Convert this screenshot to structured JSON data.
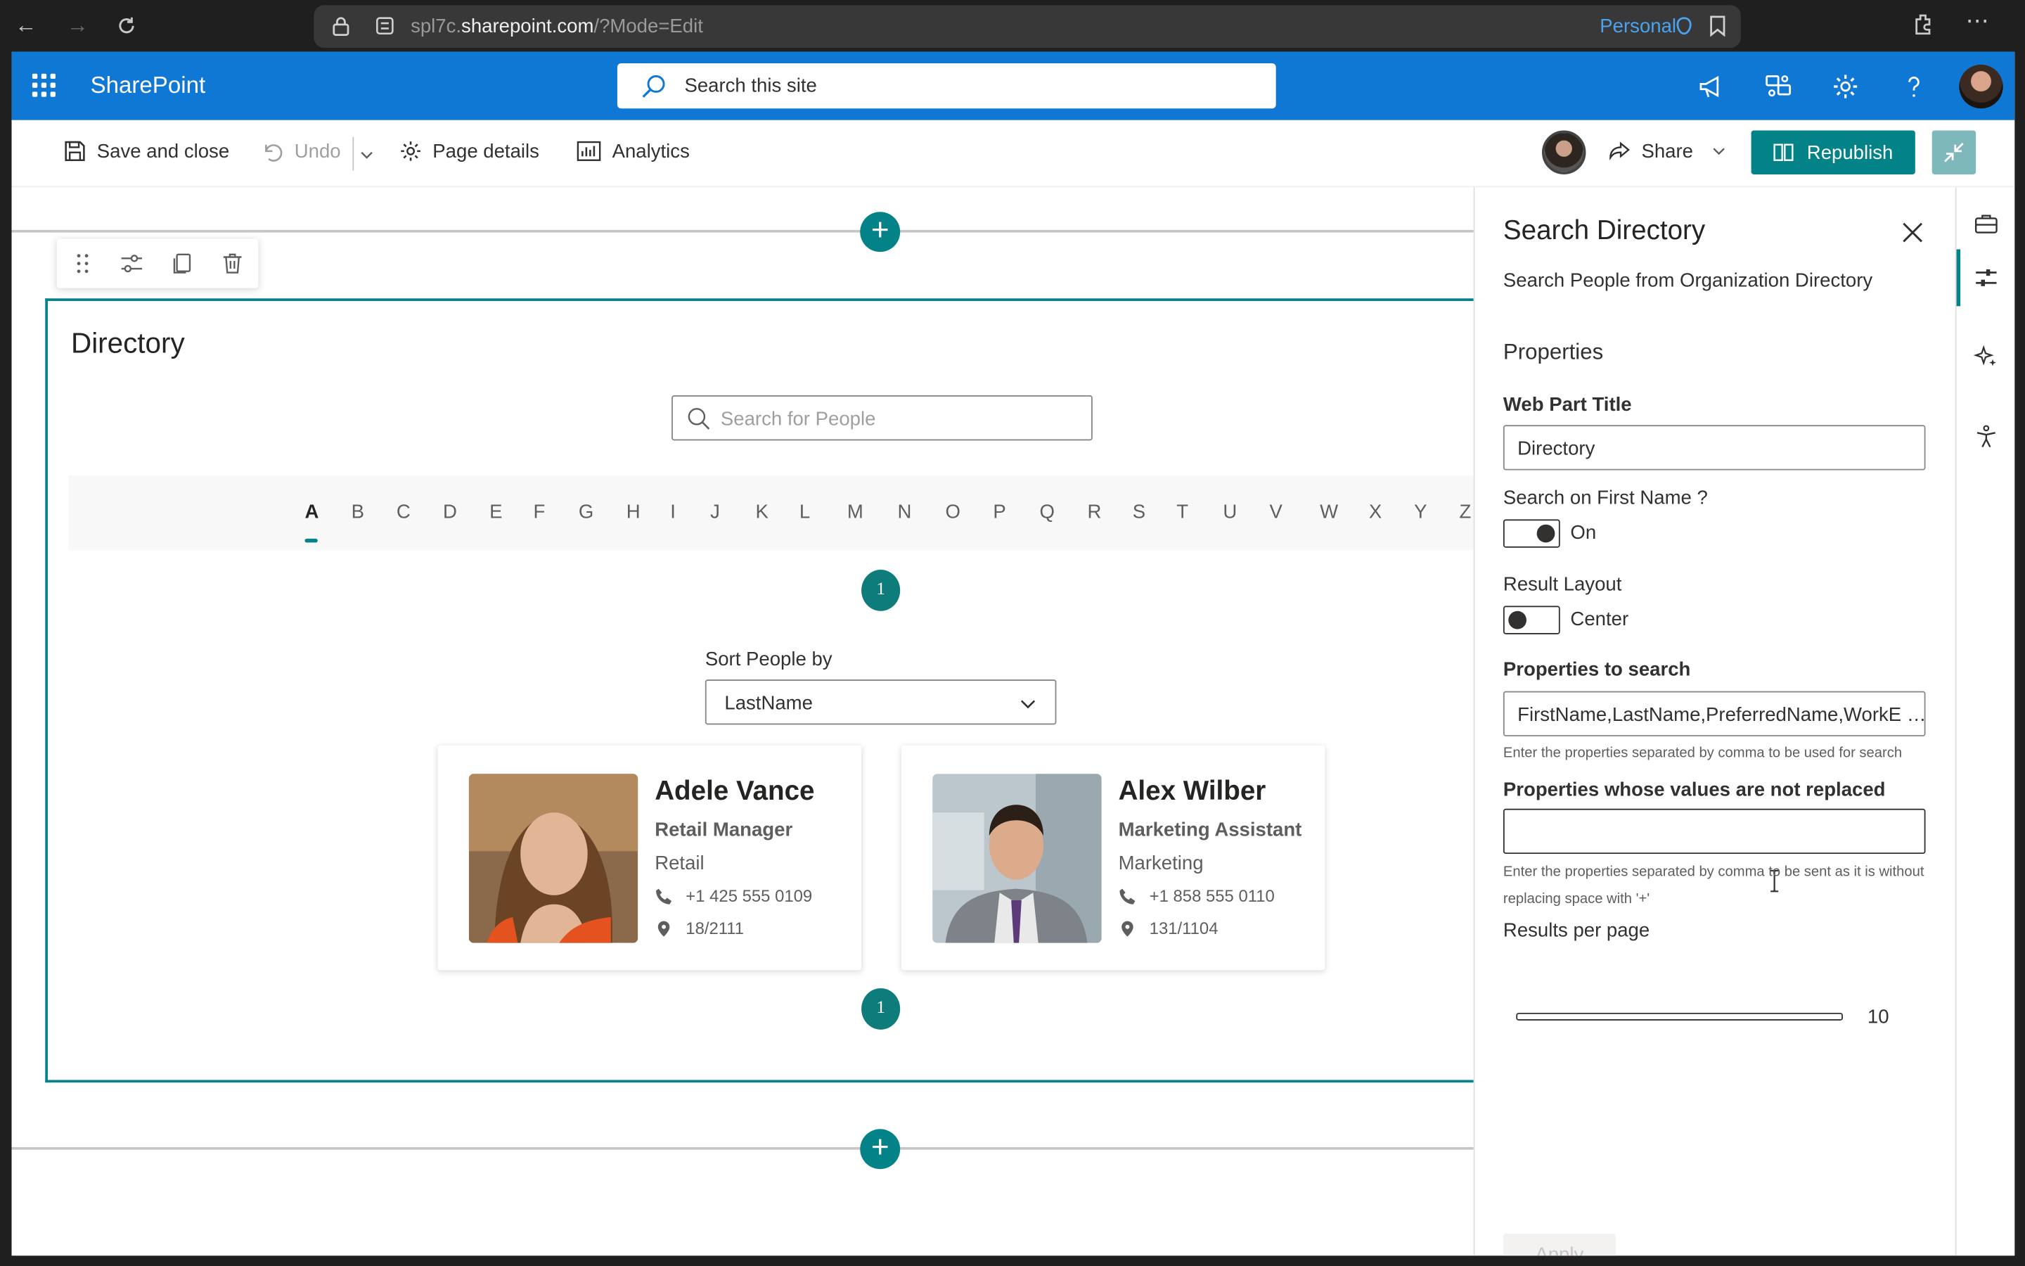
{
  "browser": {
    "url_prefix": "spl7c.",
    "url_domain": "sharepoint.com",
    "url_suffix": "/?Mode=Edit",
    "profile_label": "Personal"
  },
  "suite": {
    "brand": "SharePoint",
    "search_placeholder": "Search this site"
  },
  "commands": {
    "save_close": "Save and close",
    "undo": "Undo",
    "page_details": "Page details",
    "analytics": "Analytics",
    "share": "Share",
    "republish": "Republish"
  },
  "webpart": {
    "title": "Directory",
    "search_placeholder": "Search for People",
    "letters": [
      "A",
      "B",
      "C",
      "D",
      "E",
      "F",
      "G",
      "H",
      "I",
      "J",
      "K",
      "L",
      "M",
      "N",
      "O",
      "P",
      "Q",
      "R",
      "S",
      "T",
      "U",
      "V",
      "W",
      "X",
      "Y",
      "Z"
    ],
    "selected_letter": "A",
    "pager_page": "1",
    "sort_label": "Sort People by",
    "sort_value": "LastName",
    "people": [
      {
        "name": "Adele Vance",
        "title": "Retail Manager",
        "department": "Retail",
        "phone": "+1 425 555 0109",
        "office": "18/2111"
      },
      {
        "name": "Alex Wilber",
        "title": "Marketing Assistant",
        "department": "Marketing",
        "phone": "+1 858 555 0110",
        "office": "131/1104"
      }
    ]
  },
  "pane": {
    "title": "Search Directory",
    "description": "Search People from Organization Directory",
    "section": "Properties",
    "web_part_title_label": "Web Part Title",
    "web_part_title_value": "Directory",
    "first_name_label": "Search on First Name ?",
    "first_name_state": "On",
    "result_layout_label": "Result Layout",
    "result_layout_state": "Center",
    "props_search_label": "Properties to search",
    "props_search_value": "FirstName,LastName,PreferredName,WorkE …",
    "props_search_help": "Enter the properties separated by comma to be used for search",
    "props_noreplace_label": "Properties whose values are not replaced",
    "props_noreplace_value": "",
    "props_noreplace_help": "Enter the properties separated by comma to be sent as it is without replacing space with '+'",
    "results_label": "Results per page",
    "results_value": "10",
    "apply": "Apply"
  },
  "colors": {
    "suite_blue": "#0f78d4",
    "teal": "#038387"
  }
}
